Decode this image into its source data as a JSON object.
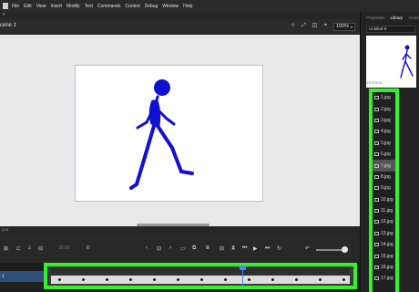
{
  "menubar": {
    "items": [
      "File",
      "Edit",
      "View",
      "Insert",
      "Modify",
      "Text",
      "Commands",
      "Control",
      "Debug",
      "Window",
      "Help"
    ],
    "close_glyph": "x"
  },
  "editbar": {
    "scene_label": "cene 1",
    "zoom": "100%",
    "icons": [
      "align-icon",
      "transform-icon",
      "clip-icon",
      "center-icon"
    ]
  },
  "timeline": {
    "header_label": "ıput",
    "fps": "30.00",
    "loop_label": "6'",
    "layer_number": "1",
    "frame_count": 13
  },
  "right_panel": {
    "tabs": [
      "Properties",
      "Library",
      "Assets"
    ],
    "active_tab": "Library",
    "document": "Untitled-9",
    "items_count": "18 items",
    "items": [
      "1.jpg",
      "2.jpg",
      "3.jpg",
      "4.jpg",
      "5.jpg",
      "6.jpg",
      "7.jpg",
      "8.jpg",
      "9.jpg",
      "10.jpg",
      "11.jpg",
      "12.jpg",
      "13.jpg",
      "14.jpg",
      "15.jpg",
      "16.jpg",
      "17.jpg"
    ],
    "selected_item": "7.jpg"
  },
  "colors": {
    "highlight": "#35f02b",
    "figure": "#1010d0",
    "playhead": "#4a8fe8",
    "stage": "#ffffff",
    "pasteboard": "#e9e9e9"
  }
}
